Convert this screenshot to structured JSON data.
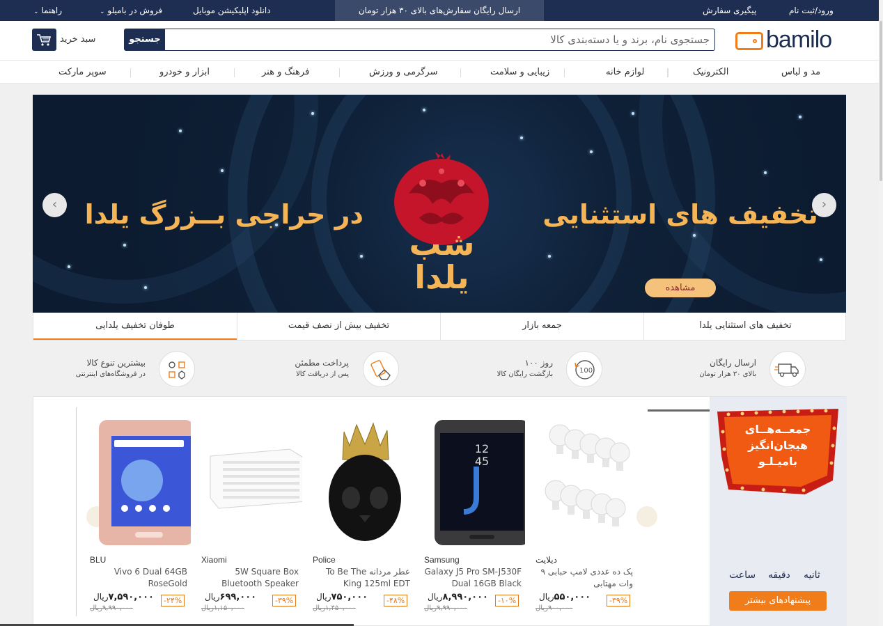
{
  "topbar": {
    "login": "ورود/ثبت نام",
    "track": "پیگیری سفارش",
    "promo": "ارسال رایگان سفارش‌های بالای ۳۰ هزار تومان",
    "download": "دانلود اپلیکیشن موبایل",
    "sell": "فروش در بامیلو",
    "help": "راهنما"
  },
  "header": {
    "logo": "bamilo",
    "search_placeholder": "جستجوی نام، برند و یا دسته‌بندی کالا",
    "search_button": "جستجو",
    "cart_label": "سبد خرید"
  },
  "categories": [
    "مد و لباس",
    "الکترونیک",
    "لوازم خانه",
    "زیبایی و سلامت",
    "سرگرمی و ورزش",
    "فرهنگ و هنر",
    "ابزار و خودرو",
    "سوپر مارکت"
  ],
  "banner": {
    "right_text": "تخفیف های استثنایی",
    "left_text": "در حراجی بــزرگ یلدا",
    "center_text": "شب یلدا",
    "view_button": "مشاهده",
    "prev_icon": "‹",
    "next_icon": "›"
  },
  "banner_tabs": [
    "تخفیف های استثنایی یلدا",
    "جمعه بازار",
    "تخفیف بیش از نصف قیمت",
    "طوفان تخفیف یلدایی"
  ],
  "features": [
    {
      "icon": "truck-icon",
      "title": "ارسال رایگان",
      "subtitle": "بالای ۳۰ هزار تومان"
    },
    {
      "icon": "return-100-icon",
      "title": "۱۰۰ روز",
      "subtitle": "بازگشت رایگان کالا"
    },
    {
      "icon": "card-payment-icon",
      "title": "پرداخت مطمئن",
      "subtitle": "پس از دریافت کالا"
    },
    {
      "icon": "variety-icon",
      "title": "بیشترین تنوع کالا",
      "subtitle": "در فروشگاه‌های اینترنتی"
    }
  ],
  "deals": {
    "promo_lines": [
      "جمعــه‌هــای",
      "هیجان‌انگیز",
      "بامیـلـو"
    ],
    "countdown": [
      "ثانیه",
      "دقیقه",
      "ساعت"
    ],
    "more_button": "پیشنهادهای بیشتر",
    "products": [
      {
        "brand": "دیلایت",
        "name": "پک ده عددی لامپ حبابی ۹ وات مهتابی",
        "price": "۵۵۰,۰۰۰",
        "currency": "ریال",
        "old_price": "۹۰۰,۰۰۰ریال",
        "discount": "-۳۹%"
      },
      {
        "brand": "Samsung",
        "name": "Galaxy J5 Pro SM-J530F Dual 16GB Black",
        "price": "۸,۹۹۰,۰۰۰",
        "currency": "ریال",
        "old_price": "۹,۹۹۰,۰۰۰ریال",
        "discount": "-۱۰%"
      },
      {
        "brand": "Police",
        "name": "عطر مردانه To Be The King 125ml EDT",
        "price": "۷۵۰,۰۰۰",
        "currency": "ریال",
        "old_price": "۱,۴۵۰,۰۰۰ریال",
        "discount": "-۴۸%"
      },
      {
        "brand": "Xiaomi",
        "name": "5W Square Box Bluetooth Speaker",
        "price": "۶۹۹,۰۰۰",
        "currency": "ریال",
        "old_price": "۱,۱۵۰,۰۰۰ریال",
        "discount": "-۳۹%"
      },
      {
        "brand": "BLU",
        "name": "Vivo 6 Dual 64GB RoseGold",
        "price": "۷,۵۹۰,۰۰۰",
        "currency": "ریال",
        "old_price": "۹,۹۹۰,۰۰۰ریال",
        "discount": "-۲۴%"
      }
    ]
  },
  "colors": {
    "navy": "#1e2d52",
    "orange": "#f07d1a",
    "banner_gold": "#f5b455",
    "pomegranate": "#c4152a"
  }
}
